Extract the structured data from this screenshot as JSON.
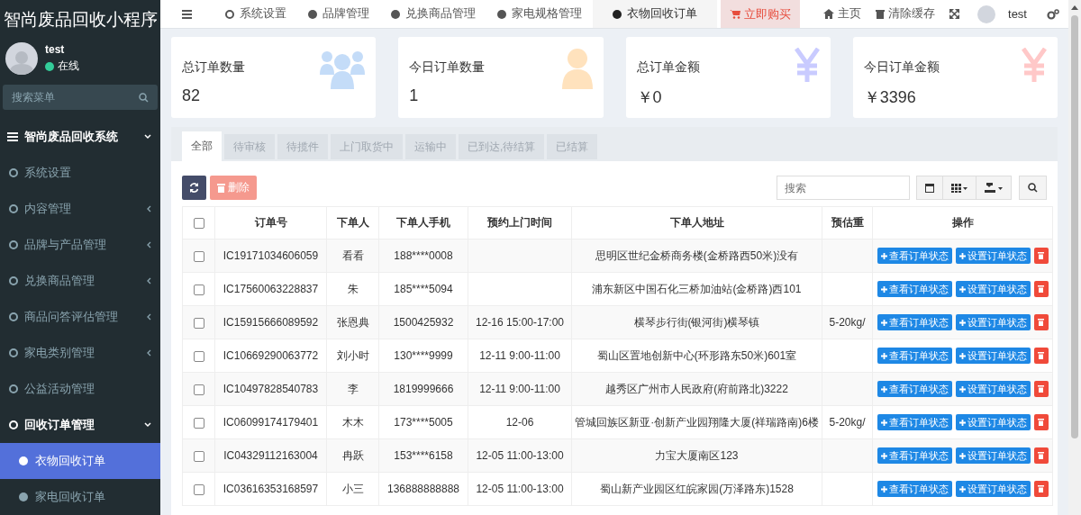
{
  "app": {
    "title": "智尚废品回收小程序"
  },
  "user": {
    "name": "test",
    "status": "在线"
  },
  "sidebar": {
    "search": {
      "placeholder": "搜索菜单"
    },
    "menu": [
      {
        "label": "智尚废品回收系统",
        "kind": "header",
        "expanded": true,
        "selected": false,
        "children": [
          {
            "label": "系统设置",
            "kind": "link",
            "selected": false
          },
          {
            "label": "内容管理",
            "kind": "group",
            "expanded": false,
            "selected": false
          },
          {
            "label": "品牌与产品管理",
            "kind": "group",
            "expanded": false,
            "selected": false
          },
          {
            "label": "兑换商品管理",
            "kind": "group",
            "expanded": false,
            "selected": false
          },
          {
            "label": "商品问答评估管理",
            "kind": "group",
            "expanded": false,
            "selected": false
          },
          {
            "label": "家电类别管理",
            "kind": "group",
            "expanded": false,
            "selected": false
          },
          {
            "label": "公益活动管理",
            "kind": "link",
            "selected": false
          },
          {
            "label": "回收订单管理",
            "kind": "group",
            "expanded": true,
            "selected": false,
            "children": [
              {
                "label": "衣物回收订单",
                "selected": true
              },
              {
                "label": "家电回收订单",
                "selected": false
              }
            ]
          }
        ]
      }
    ]
  },
  "topbar": {
    "tabs": [
      {
        "label": "系统设置",
        "kind": "outline",
        "selected": false
      },
      {
        "label": "品牌管理",
        "kind": "solid",
        "selected": false
      },
      {
        "label": "兑换商品管理",
        "kind": "solid",
        "selected": false
      },
      {
        "label": "家电规格管理",
        "kind": "solid",
        "selected": false
      },
      {
        "label": "衣物回收订单",
        "kind": "solid",
        "selected": true
      }
    ],
    "buy_button": "立即购买",
    "home": "主页",
    "clear_cache": "清除缓存",
    "user": "test"
  },
  "stats": [
    {
      "title": "总订单数量",
      "value": "82",
      "kind": "users",
      "color": "#c4dcf8"
    },
    {
      "title": "今日订单数量",
      "value": "1",
      "kind": "user",
      "color": "#ffe2bd"
    },
    {
      "title": "总订单金额",
      "value": "￥0",
      "kind": "yen",
      "color": "#c9cbff"
    },
    {
      "title": "今日订单金额",
      "value": "￥3396",
      "kind": "yen",
      "color": "#ffc8c8"
    }
  ],
  "status_tabs": [
    {
      "label": "全部",
      "selected": true
    },
    {
      "label": "待审核",
      "selected": false
    },
    {
      "label": "待揽件",
      "selected": false
    },
    {
      "label": "上门取货中",
      "selected": false
    },
    {
      "label": "运输中",
      "selected": false
    },
    {
      "label": "已到达,待结算",
      "selected": false
    },
    {
      "label": "已结算",
      "selected": false
    }
  ],
  "toolbar": {
    "delete_button": {
      "label": "删除",
      "disabled": true
    },
    "search": {
      "placeholder": "搜索"
    }
  },
  "table": {
    "all_checked": false,
    "columns": [
      "订单号",
      "下单人",
      "下单人手机",
      "预约上门时间",
      "下单人地址",
      "预估重",
      "操作"
    ],
    "rows": [
      {
        "checked": false,
        "cells": [
          "IC19171034606059",
          "看看",
          "188****0008",
          "",
          "思明区世纪金桥商务楼(金桥路西50米)没有",
          ""
        ],
        "actions": [
          "查看订单状态",
          "设置订单状态"
        ]
      },
      {
        "checked": false,
        "cells": [
          "IC17560063228837",
          "朱",
          "185****5094",
          "",
          "浦东新区中国石化三桥加油站(金桥路)西101",
          ""
        ],
        "actions": [
          "查看订单状态",
          "设置订单状态"
        ]
      },
      {
        "checked": false,
        "cells": [
          "IC15915666089592",
          "张恩典",
          "1500425932",
          "12-16 15:00-17:00",
          "横琴步行街(银河街)横琴镇",
          "5-20kg/"
        ],
        "actions": [
          "查看订单状态",
          "设置订单状态"
        ]
      },
      {
        "checked": false,
        "cells": [
          "IC10669290063772",
          "刘小时",
          "130****9999",
          "12-11 9:00-11:00",
          "蜀山区置地创新中心(环形路东50米)601室",
          ""
        ],
        "actions": [
          "查看订单状态",
          "设置订单状态"
        ]
      },
      {
        "checked": false,
        "cells": [
          "IC10497828540783",
          "李",
          "1819999666",
          "12-11 9:00-11:00",
          "越秀区广州市人民政府(府前路北)3222",
          ""
        ],
        "actions": [
          "查看订单状态",
          "设置订单状态"
        ]
      },
      {
        "checked": false,
        "cells": [
          "IC06099174179401",
          "木木",
          "173****5005",
          "12-06",
          "管城回族区新亚·创新产业园翔隆大厦(祥瑞路南)6楼",
          "5-20kg/"
        ],
        "actions": [
          "查看订单状态",
          "设置订单状态"
        ]
      },
      {
        "checked": false,
        "cells": [
          "IC04329112163004",
          "冉跃",
          "153****6158",
          "12-05 11:00-13:00",
          "力宝大厦南区123",
          ""
        ],
        "actions": [
          "查看订单状态",
          "设置订单状态"
        ]
      },
      {
        "checked": false,
        "cells": [
          "IC03616353168597",
          "小三",
          "136888888888",
          "12-05 11:00-13:00",
          "蜀山新产业园区红皖家园(万泽路东)1528",
          ""
        ],
        "actions": [
          "查看订单状态",
          "设置订单状态"
        ]
      }
    ]
  }
}
